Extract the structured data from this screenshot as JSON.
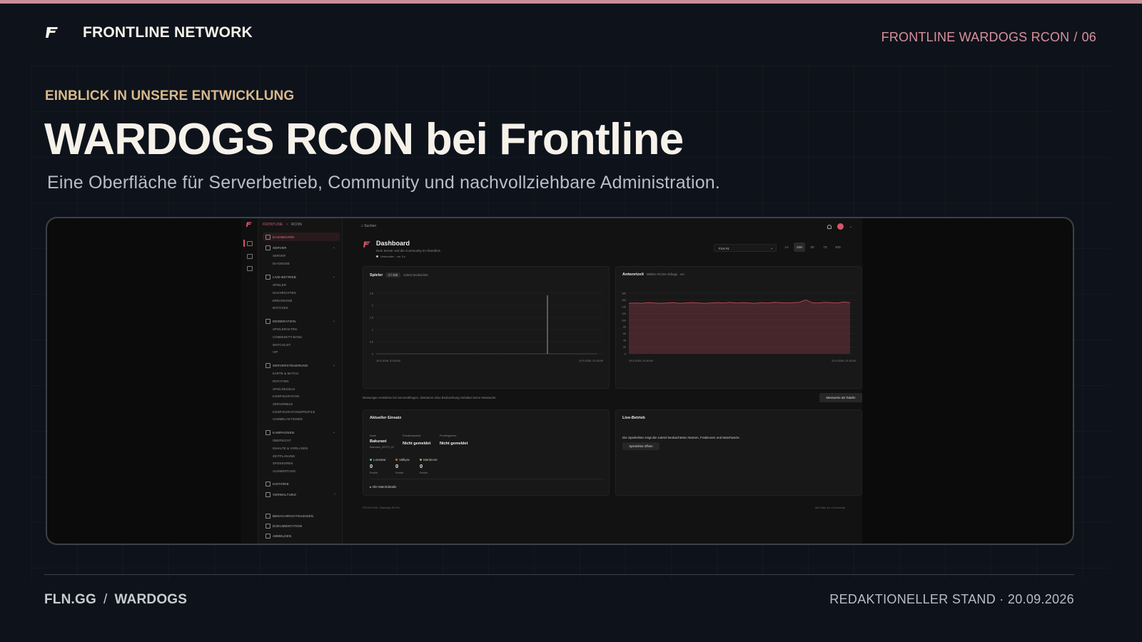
{
  "header": {
    "brand": "FRONTLINE NETWORK",
    "deck_name": "FRONTLINE WARDOGS RCON",
    "deck_sep": "/",
    "page_number": "06"
  },
  "hero": {
    "eyebrow": "EINBLICK IN UNSERE ENTWICKLUNG",
    "title": "WARDOGS RCON bei Frontline",
    "subtitle": "Eine Oberfläche für Serverbetrieb, Community und nachvollziehbare Administration."
  },
  "app": {
    "breadcrumb": [
      "FRONTLINE",
      "RCON"
    ],
    "breadcrumb_sep": ">",
    "search_placeholder": "Suchen",
    "sidebar": {
      "dashboard": "DASHBOARD",
      "server": {
        "label": "SERVER",
        "items": [
          "SERVER",
          "DIAGNOSE"
        ]
      },
      "live": {
        "label": "LIVE-BETRIEB",
        "items": [
          "SPIELER",
          "NACHRICHTEN",
          "EREIGNISSE",
          "MATCHES"
        ]
      },
      "moderation": {
        "label": "MODERATION",
        "items": [
          "SPIELERAKTEN",
          "COMMUNITY-BANS",
          "WATCHLIST",
          "VIP"
        ]
      },
      "control": {
        "label": "SERVERSTEUERUNG",
        "items": [
          "KARTE & MATCH",
          "ROTATION",
          "SPIELREGELN",
          "KONFIGURATION",
          "SERVERBILD",
          "KONFIGURATIONSPROFILE",
          "SAMMELAKTIONEN"
        ]
      },
      "campaigns": {
        "label": "KAMPAGNEN",
        "items": [
          "ÜBERSICHT",
          "INHALTE & VORLAGEN",
          "ZEITPLANUNG",
          "SPONSOREN",
          "AUSWERTUNG"
        ]
      },
      "history": "HISTORIE",
      "admin": "VERWALTUNG",
      "notifications": "BENACHRICHTIGUNGEN",
      "docs": "DOKUMENTATION",
      "logout": "ABMELDEN"
    },
    "dashboard": {
      "title": "Dashboard",
      "subtitle": "Dein Server und die Community im Überblick.",
      "status": "Verbunden · vor 3 s",
      "server_select": "FLN #1",
      "ranges": [
        "1H",
        "24H",
        "3D",
        "7D",
        "30D"
      ],
      "active_range": "24H"
    },
    "players_card": {
      "title": "Spieler",
      "badge": "0 / 100",
      "note": "Zuletzt beobachtet"
    },
    "response_card": {
      "title": "Antwortzeit",
      "note": "Mittlere RCON-Abfrage · ms"
    },
    "measure_note": "Messungen entstehen bei Serverabfragen. Zeiträume ohne Beobachtung enthalten keine Messwerte.",
    "table_button": "Messwerte als Tabelle",
    "deployment": {
      "title": "Aktueller Einsatz",
      "map_label": "Karte",
      "map_value": "Bakurani",
      "map_sub": "Bakurani_AOTH_01",
      "round_label": "Rundenlaufzeit",
      "round_value": "Nicht gemeldet",
      "points_label": "Punktegrenze",
      "points_value": "Nicht gemeldet",
      "factions": [
        {
          "name": "Lonestar",
          "score": "0",
          "label": "Punkte",
          "color": "#58b7c9"
        },
        {
          "name": "Valkyra",
          "score": "0",
          "label": "Punkte",
          "color": "#d66a3f"
        },
        {
          "name": "Manticore",
          "score": "0",
          "label": "Punkte",
          "color": "#7fbf5a"
        }
      ],
      "details": "▸ Alle Matchdetails"
    },
    "live_card": {
      "title": "Live-Betrieb",
      "text": "Die Spielerliste zeigt die zuletzt beobachteten Namen, Fraktionen und Matchwerte.",
      "button": "Spielerliste öffnen"
    },
    "footer_left": "FRONTLINE  |  Wardogs RCON",
    "footer_right": "Mit Liebe zur Community"
  },
  "chart_data": [
    {
      "type": "line",
      "title": "Spieler",
      "x_ticks": [
        "19.9.2026, 01:30:00",
        "20.9.2026, 01:30:00"
      ],
      "y_ticks": [
        0,
        0.5,
        1.0,
        1.5,
        2.0,
        2.5
      ],
      "ylim": [
        0,
        2.5
      ],
      "series": [
        {
          "values": [
            0,
            0,
            0,
            0,
            0,
            0,
            0,
            0,
            0,
            0
          ]
        }
      ]
    },
    {
      "type": "area",
      "title": "Antwortzeit",
      "x_ticks": [
        "19.9.2026, 01:30:00",
        "20.9.2026, 01:30:00"
      ],
      "y_ticks": [
        0,
        20,
        40,
        60,
        80,
        100,
        120,
        140,
        160,
        180
      ],
      "ylim": [
        0,
        180
      ],
      "series": [
        {
          "values": [
            150,
            151,
            150,
            152,
            151,
            150,
            151,
            152,
            150,
            151,
            152,
            151,
            150,
            151,
            152,
            151,
            153,
            151,
            152,
            151,
            150,
            152,
            151,
            153,
            152,
            151,
            152,
            153,
            160,
            152,
            151,
            153,
            152,
            151,
            154,
            152
          ]
        }
      ],
      "color": "#c24d5d"
    }
  ],
  "footer": {
    "site": "FLN.GG",
    "sep": "/",
    "section": "WARDOGS",
    "status": "REDAKTIONELLER STAND · 20.09.2026"
  }
}
